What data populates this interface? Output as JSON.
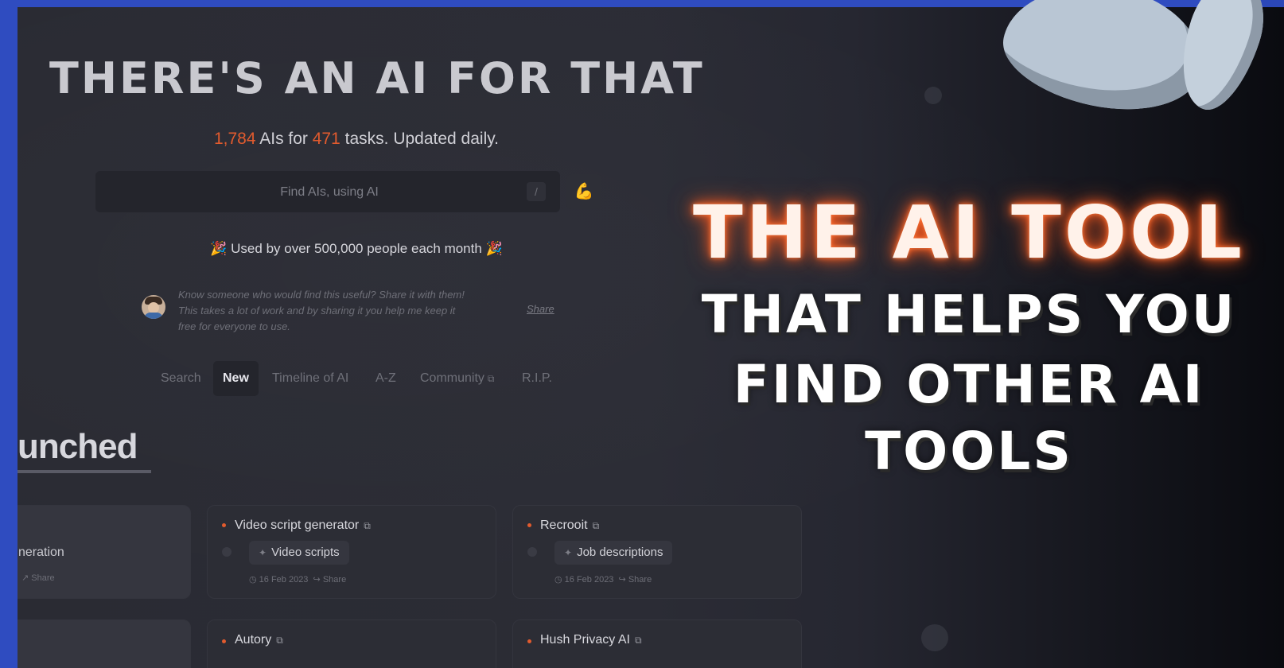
{
  "site": {
    "title": "THERE'S AN AI FOR THAT",
    "stats": {
      "ai_count": "1,784",
      "mid_1": " AIs for ",
      "task_count": "471",
      "mid_2": " tasks. Updated daily."
    },
    "search": {
      "placeholder": "Find AIs, using AI",
      "shortcut_key": "/",
      "flex_icon": "flexed-biceps-icon"
    },
    "used_by": "🎉 Used by over 500,000 people each month 🎉",
    "share_note": {
      "lines": [
        "Know someone who would find this useful? Share it with them!",
        "This takes a lot of work and by sharing it you help me keep it",
        "free for everyone to use."
      ],
      "link": "Share"
    },
    "tabs": [
      {
        "label": "Search",
        "active": false
      },
      {
        "label": "New",
        "active": true
      },
      {
        "label": "Timeline of AI",
        "active": false
      },
      {
        "label": "A-Z",
        "active": false
      },
      {
        "label": "Community",
        "active": false,
        "external": true
      },
      {
        "label": "R.I.P.",
        "active": false
      }
    ],
    "section_heading": "unched",
    "cards": [
      {
        "partial_text": "neration",
        "partial_meta": "↗ Share"
      },
      {
        "name": "Video script generator",
        "task": "Video scripts",
        "date": "16 Feb 2023",
        "share": "Share"
      },
      {
        "name": "Recrooit",
        "task": "Job descriptions",
        "date": "16 Feb 2023",
        "share": "Share"
      },
      {
        "name": "Autory"
      },
      {
        "name": "Hush Privacy AI"
      }
    ],
    "colors": {
      "accent": "#e25b2e",
      "border": "#2f4cc0"
    }
  },
  "overlay": {
    "line1": "THE AI TOOL",
    "line2": "THAT HELPS YOU",
    "line3": "FIND OTHER AI",
    "line4": "TOOLS"
  }
}
